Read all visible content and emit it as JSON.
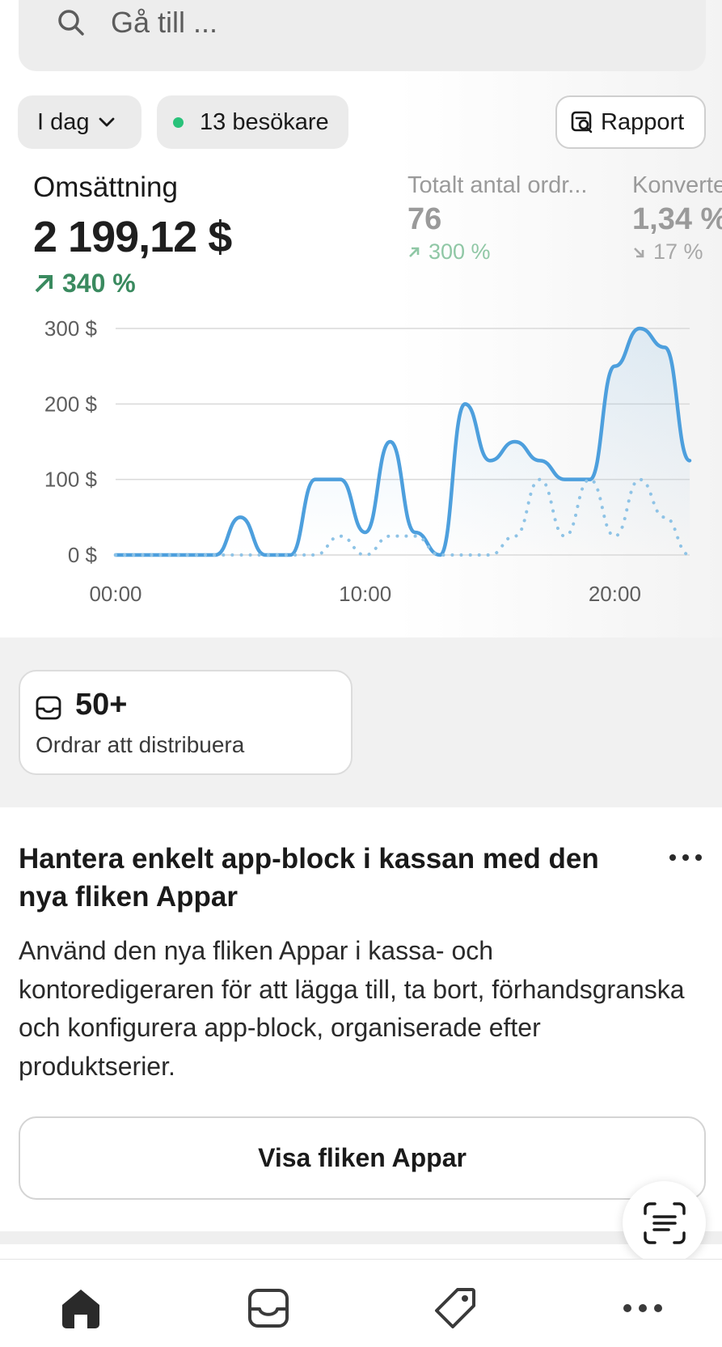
{
  "search": {
    "placeholder": "Gå till ..."
  },
  "filters": {
    "date_label": "I dag",
    "visitors_label": "13 besökare",
    "report_label": "Rapport"
  },
  "metrics": {
    "revenue": {
      "label": "Omsättning",
      "value": "2 199,12 $",
      "change": "340 %"
    },
    "orders": {
      "label": "Totalt antal ordr...",
      "value": "76",
      "change": "300 %"
    },
    "conversion": {
      "label": "Konverte",
      "value": "1,34 %",
      "change": "17 %"
    }
  },
  "chart_data": {
    "type": "line",
    "y_ticks": [
      "300 $",
      "200 $",
      "100 $",
      "0 $"
    ],
    "x_ticks": [
      "00:00",
      "10:00",
      "20:00"
    ],
    "ylim": [
      0,
      300
    ],
    "x": [
      0,
      1,
      2,
      3,
      4,
      5,
      6,
      7,
      8,
      9,
      10,
      11,
      12,
      13,
      14,
      15,
      16,
      17,
      18,
      19,
      20,
      21,
      22,
      23
    ],
    "series": [
      {
        "style": "solid",
        "values": [
          0,
          0,
          0,
          0,
          0,
          50,
          0,
          0,
          100,
          100,
          30,
          150,
          30,
          0,
          200,
          125,
          150,
          125,
          100,
          100,
          250,
          300,
          275,
          125
        ]
      },
      {
        "style": "dotted",
        "values": [
          0,
          0,
          0,
          0,
          0,
          0,
          0,
          0,
          0,
          25,
          0,
          25,
          25,
          0,
          0,
          0,
          25,
          100,
          25,
          100,
          25,
          100,
          50,
          0
        ]
      }
    ],
    "grid": true,
    "colors": {
      "primary": "#4d9fdd",
      "comparison": "#8ec3e6"
    }
  },
  "orders_card": {
    "count": "50+",
    "label": "Ordrar att distribuera"
  },
  "promo": {
    "title": "Hantera enkelt app-block i kassan med den nya fliken Appar",
    "body": "Använd den nya fliken Appar i kassa- och kontoredigeraren för att lägga till, ta bort, förhandsgranska och konfigurera app-block, organiserade efter produktserier.",
    "button_label": "Visa fliken Appar"
  },
  "tabbar": {
    "items": [
      "home-icon",
      "inbox-icon",
      "tag-icon",
      "more-icon"
    ]
  },
  "colors": {
    "positive": "#3a8a5f",
    "accent_dot": "#29c27a"
  }
}
